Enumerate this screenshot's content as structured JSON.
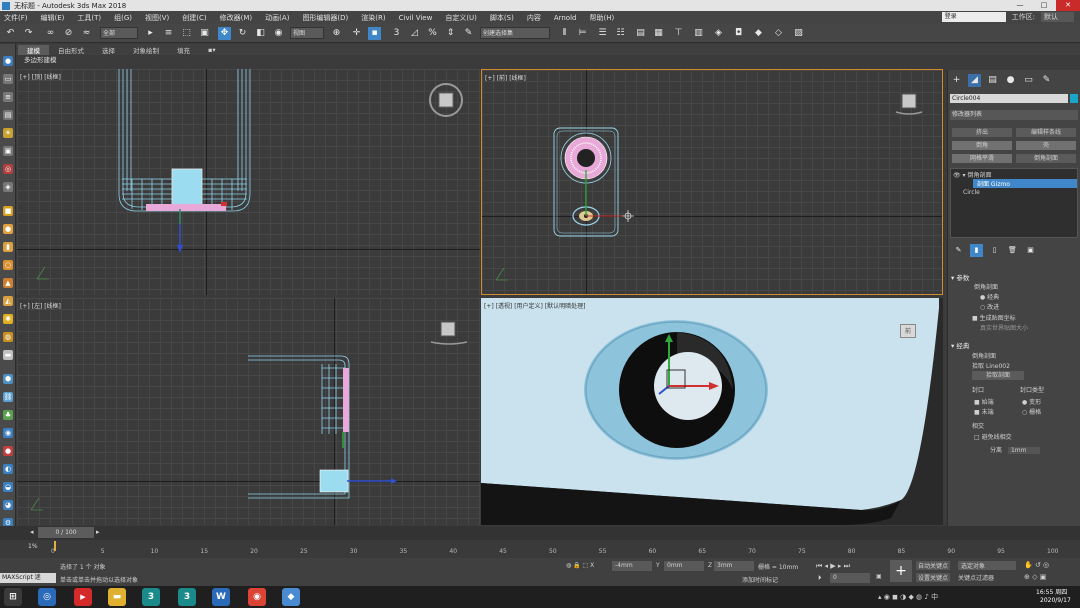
{
  "window": {
    "title": "无标题 - Autodesk 3ds Max 2018",
    "controls": [
      "—",
      "□",
      "✕"
    ]
  },
  "menu": {
    "items": [
      "文件(F)",
      "编辑(E)",
      "工具(T)",
      "组(G)",
      "视图(V)",
      "创建(C)",
      "修改器(M)",
      "动画(A)",
      "图形编辑器(D)",
      "渲染(R)",
      "Civil View",
      "自定义(U)",
      "脚本(S)",
      "内容",
      "Arnold",
      "帮助(H)"
    ],
    "login": "登录",
    "workspace_label": "工作区:",
    "workspace_value": "默认"
  },
  "toolbar": {
    "filter": "全部",
    "view": "视图",
    "selection_set": "创建选择集"
  },
  "ribbon": {
    "tabs": [
      "建模",
      "自由形式",
      "选择",
      "对象绘制",
      "填充"
    ],
    "sub": "多边形建模"
  },
  "viewports": {
    "top": "[+] [顶] [线框]",
    "front": "[+] [前] [线框]",
    "left": "[+] [左] [线框]",
    "persp": "[+] [透视] [用户定义] [默认明暗处理]",
    "viewcube_persp": "前"
  },
  "command_panel": {
    "object_name": "Circle004",
    "modifier_list": "修改器列表",
    "buttons": [
      "挤出",
      "编辑样条线",
      "倒角",
      "壳",
      "网格平滑",
      "倒角剖面"
    ],
    "stack": [
      "倒角剖面",
      "剖面 Gizmo",
      "Circle"
    ],
    "rollout1": {
      "title": "参数",
      "group": "倒角剖面",
      "opt1": "经典",
      "opt2": "改进",
      "opt3": "生成贴图坐标",
      "opt4": "真实世界贴图大小"
    },
    "rollout2": {
      "title": "经典",
      "group": "倒角剖面",
      "shape_label": "拾取",
      "shape_value": "Line002",
      "pick_btn": "拾取剖面",
      "cap": "封口",
      "cap_start": "始端",
      "cap_end": "末端",
      "cap_type": "封口类型",
      "cap_morph": "变形",
      "cap_grid": "栅格",
      "intersect": "相交",
      "avoid": "避免线相交",
      "sep": "分离",
      "sep_val": "1mm"
    }
  },
  "timeline": {
    "frame": "0 / 100",
    "ticks": [
      "0",
      "5",
      "10",
      "15",
      "20",
      "25",
      "30",
      "35",
      "40",
      "45",
      "50",
      "55",
      "60",
      "65",
      "70",
      "75",
      "80",
      "85",
      "90",
      "95",
      "100"
    ]
  },
  "status": {
    "script": "MAXScript 迷",
    "selected": "选择了 1 个 对象",
    "hint": "单击或单击并拖动以选择对象",
    "x": "-4mm",
    "y": "0mm",
    "z": "3mm",
    "grid": "栅格 = 10mm",
    "addtime": "添加时间标记",
    "autokey": "自动关键点",
    "setkey": "设置关键点",
    "selset": "选定对象",
    "keyfilter": "关键点过滤器",
    "frame_val": "0"
  },
  "taskbar": {
    "time": "16:55 周四",
    "date": "2020/9/17"
  }
}
